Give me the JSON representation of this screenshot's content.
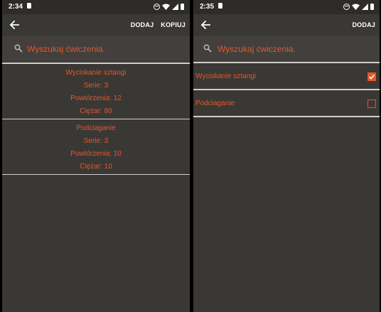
{
  "left": {
    "status": {
      "time": "2:34"
    },
    "toolbar": {
      "add_label": "DODAJ",
      "copy_label": "KOPIUJ"
    },
    "search": {
      "placeholder": "Wyszukaj ćwiczenia."
    },
    "exercises": [
      {
        "name": "Wyciskanie sztangi",
        "sets": "Serie: 3",
        "reps": "Powtórzenia: 12",
        "weight": "Ciężar: 80"
      },
      {
        "name": "Podciaganie",
        "sets": "Serie: 3",
        "reps": "Powtórzenia: 10",
        "weight": "Ciężar: 10"
      }
    ]
  },
  "right": {
    "status": {
      "time": "2:35"
    },
    "toolbar": {
      "add_label": "DODAJ"
    },
    "search": {
      "placeholder": "Wyszukaj ćwiczenia."
    },
    "items": [
      {
        "label": "Wyciskanie sztangi",
        "checked": true
      },
      {
        "label": "Podciaganie",
        "checked": false
      }
    ]
  },
  "colors": {
    "accent": "#e4582c",
    "background": "#3a3835",
    "search_background": "#423f3c",
    "status_bar": "#2e2c2a",
    "divider": "#cfcecb"
  },
  "icons": [
    "back-arrow-icon",
    "search-icon",
    "checkbox-checked-icon",
    "checkbox-unchecked-icon",
    "wifi-icon",
    "signal-icon",
    "battery-icon",
    "dnd-icon",
    "sd-card-icon"
  ]
}
